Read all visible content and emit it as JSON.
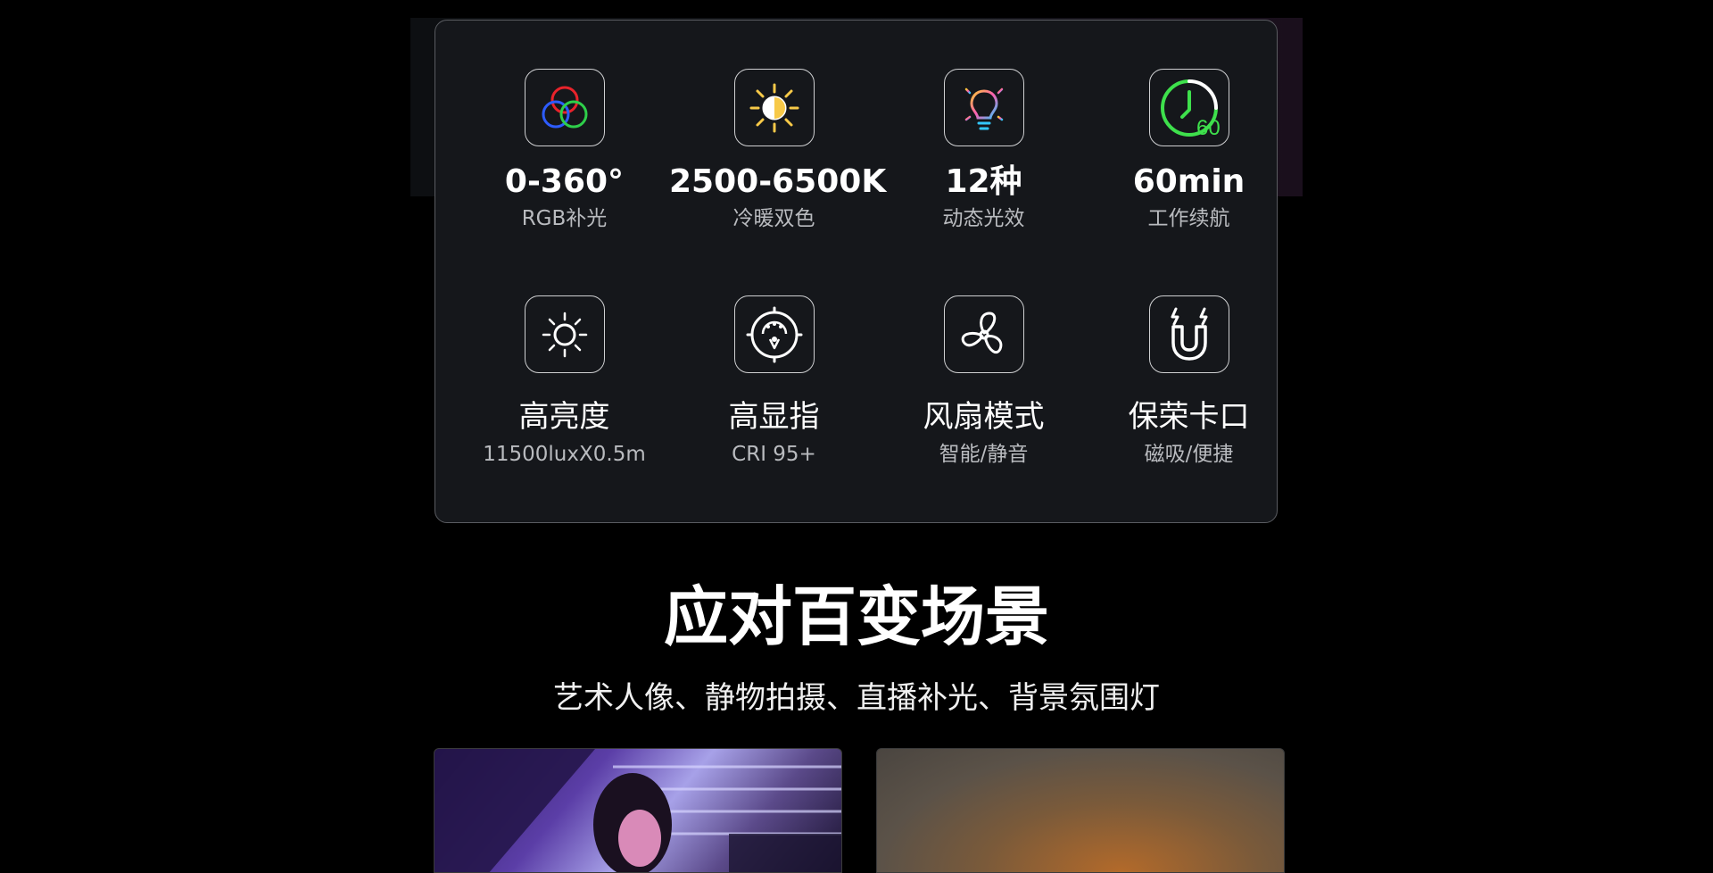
{
  "specs": [
    {
      "icon": "rgb-circles-icon",
      "value": "0-360°",
      "label": "RGB补光"
    },
    {
      "icon": "half-sun-icon",
      "value": "2500-6500K",
      "label": "冷暖双色"
    },
    {
      "icon": "lightbulb-icon",
      "value": "12种",
      "label": "动态光效"
    },
    {
      "icon": "clock-60-icon",
      "value": "60min",
      "label": "工作续航",
      "icon_text": "60"
    },
    {
      "icon": "sun-icon",
      "value": "高亮度",
      "label": "11500luxX0.5m"
    },
    {
      "icon": "cri-dial-icon",
      "value": "高显指",
      "label": "CRI 95+"
    },
    {
      "icon": "fan-icon",
      "value": "风扇模式",
      "label": "智能/静音"
    },
    {
      "icon": "magnet-icon",
      "value": "保荣卡口",
      "label": "磁吸/便捷"
    }
  ],
  "section": {
    "title": "应对百变场景",
    "subtitle": "艺术人像、静物拍摄、直播补光、背景氛围灯"
  },
  "colors": {
    "rgb_red": "#e8232b",
    "rgb_green": "#2ecf4a",
    "rgb_blue": "#2d5cff",
    "warm_yellow": "#f7c948",
    "clock_green": "#3ee04c"
  }
}
